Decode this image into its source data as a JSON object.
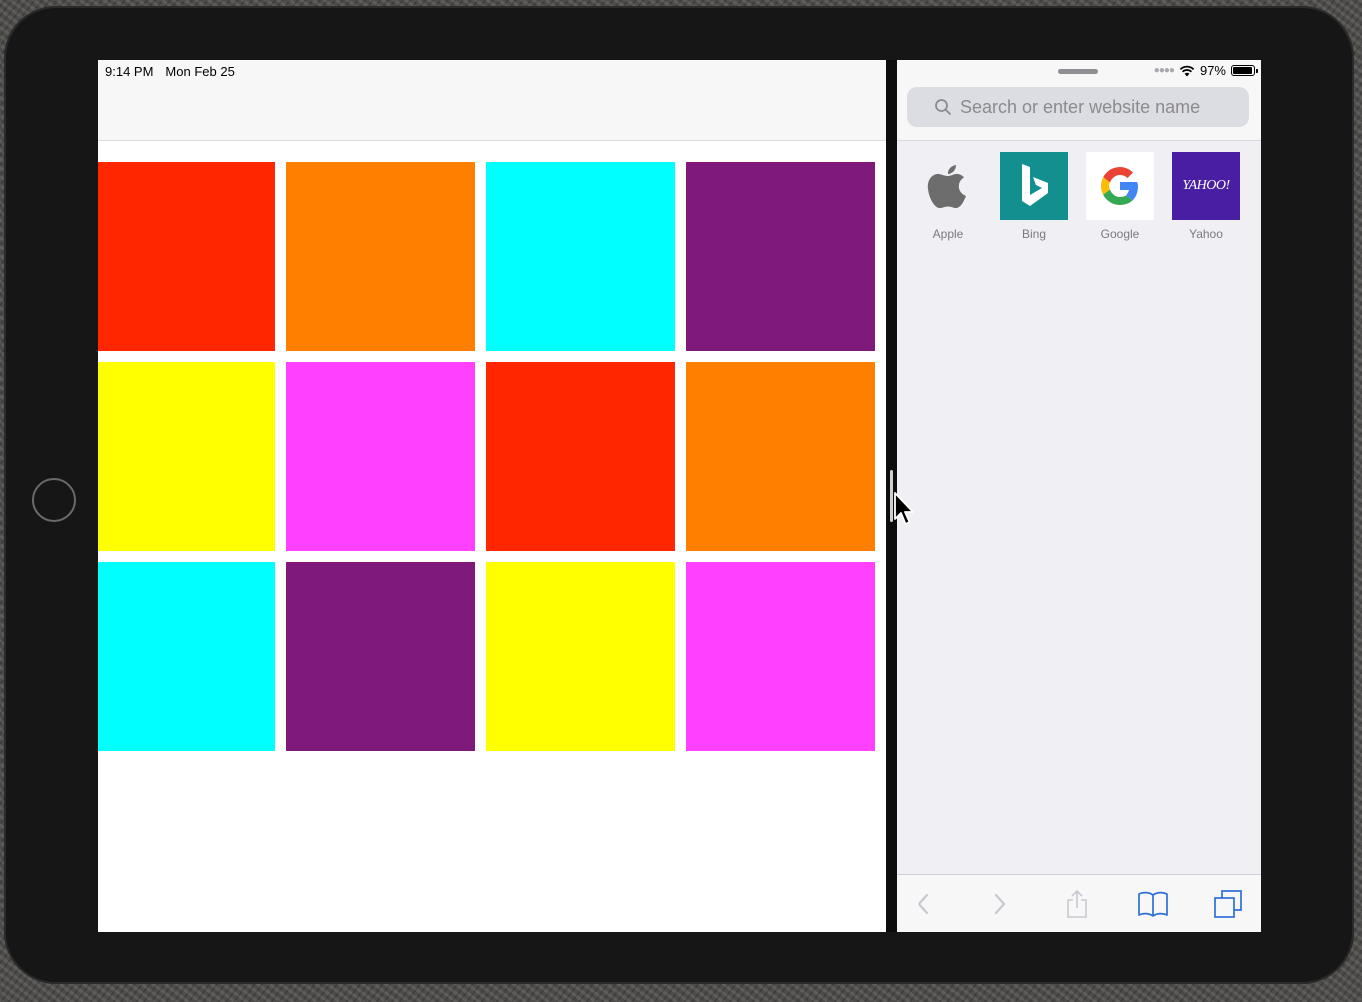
{
  "status_bar": {
    "time": "9:14 PM",
    "date": "Mon Feb 25",
    "battery": "97%"
  },
  "colors": {
    "red": "#ff2600",
    "orange": "#ff8000",
    "cyan": "#00ffff",
    "purple": "#7f1a7b",
    "yellow": "#ffff00",
    "magenta": "#ff40ff"
  },
  "tiles": [
    [
      "#ff2600",
      "#ff8000",
      "#00ffff",
      "#7f1a7b"
    ],
    [
      "#ffff00",
      "#ff40ff",
      "#ff2600",
      "#ff8000"
    ],
    [
      "#00ffff",
      "#7f1a7b",
      "#ffff00",
      "#ff40ff"
    ]
  ],
  "safari": {
    "search_placeholder": "Search or enter website name",
    "favorites": [
      {
        "label": "Apple",
        "icon": "apple-logo-icon"
      },
      {
        "label": "Bing",
        "icon": "bing-logo-icon"
      },
      {
        "label": "Google",
        "icon": "google-logo-icon"
      },
      {
        "label": "Yahoo",
        "icon": "yahoo-logo-icon"
      }
    ],
    "yahoo_logo_text": "YAHOO!",
    "toolbar": [
      "back-icon",
      "forward-icon",
      "share-icon",
      "bookmarks-icon",
      "tabs-icon"
    ],
    "accent": "#2f6fd6"
  }
}
